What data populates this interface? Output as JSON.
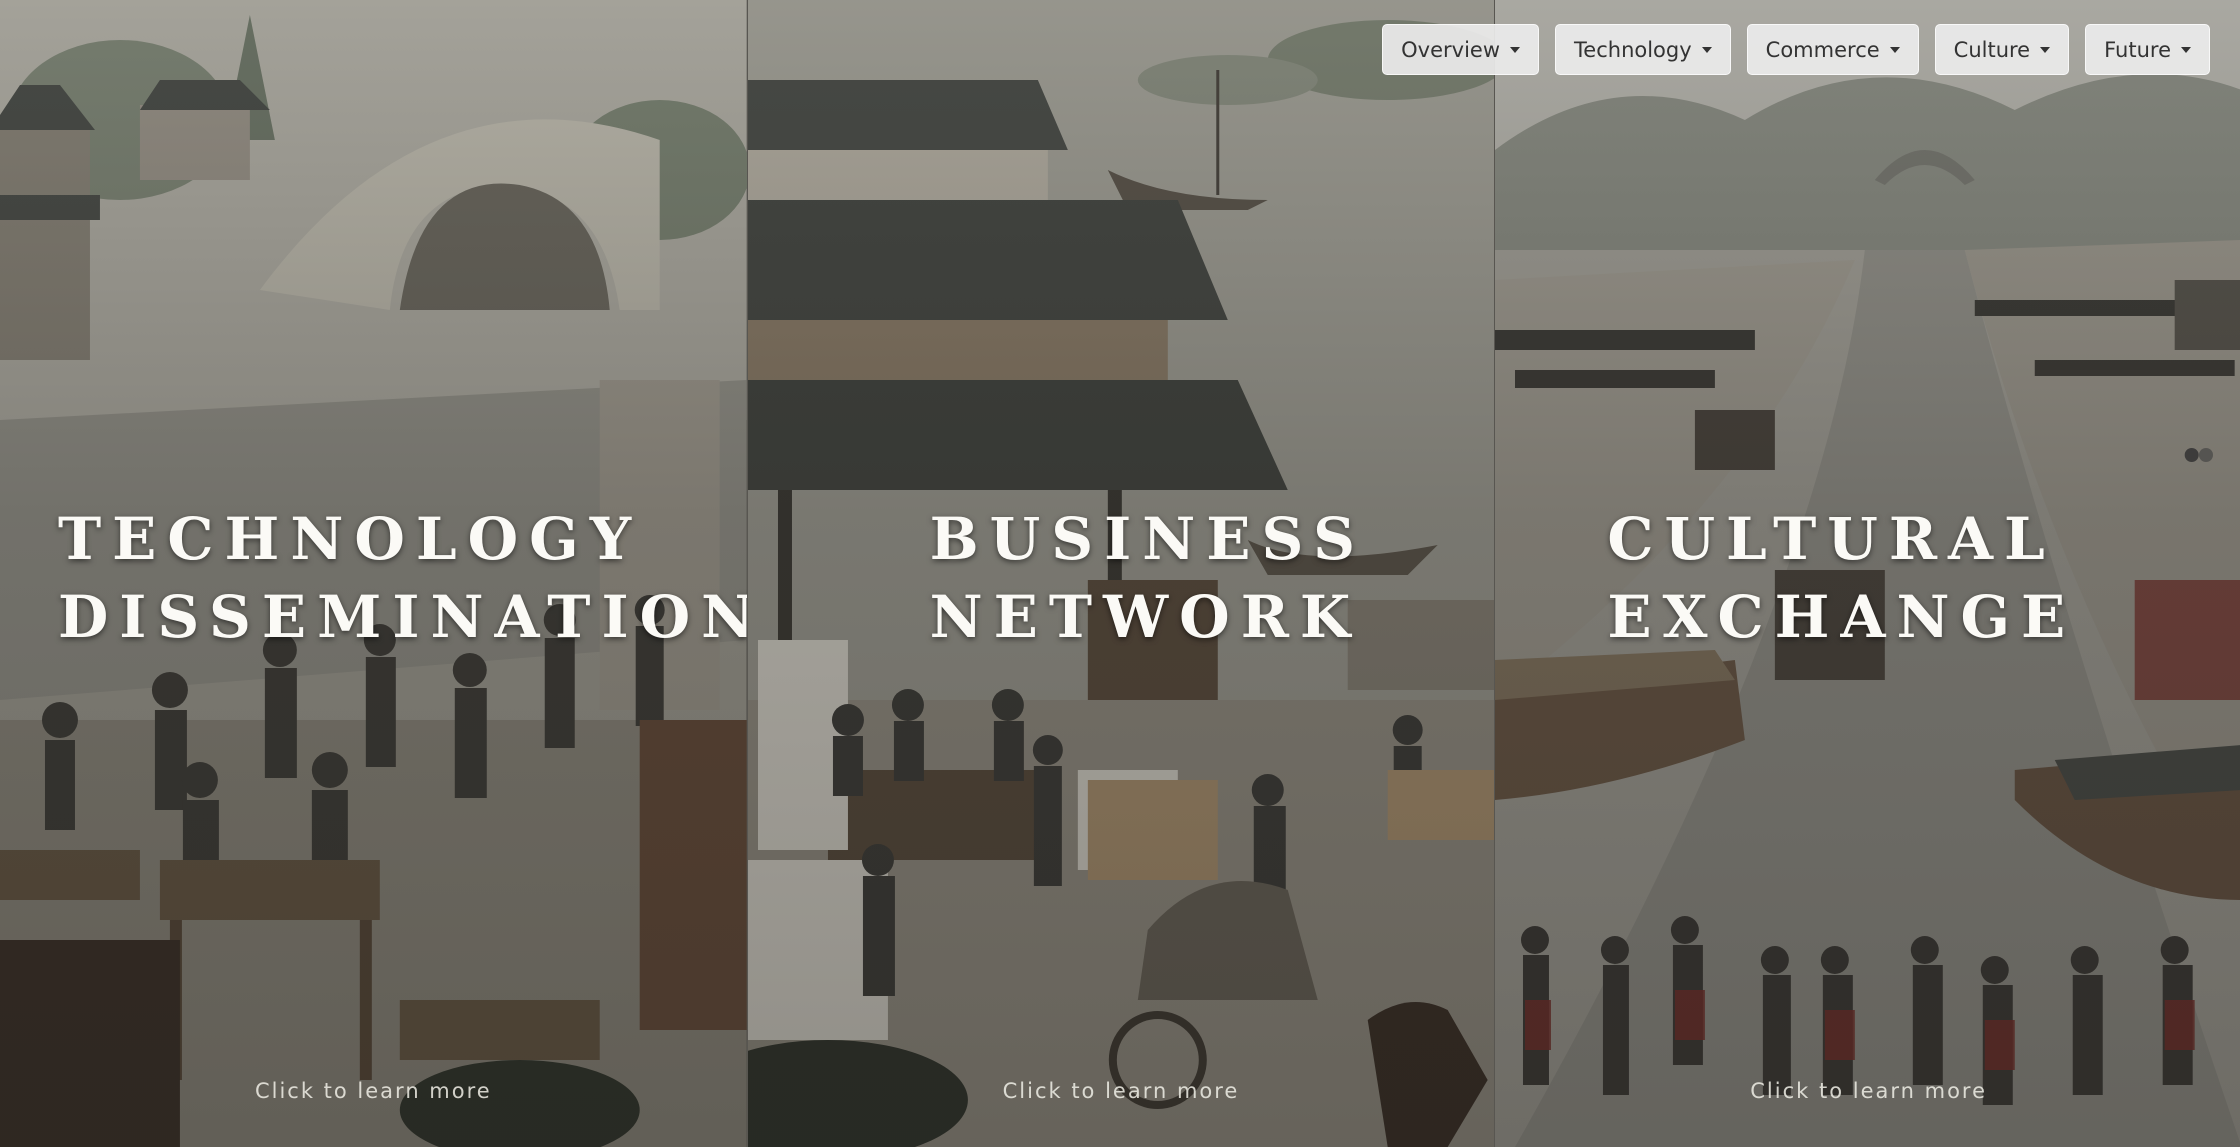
{
  "nav": [
    {
      "label": "Overview",
      "icon": "caret-down-icon"
    },
    {
      "label": "Technology",
      "icon": "caret-down-icon"
    },
    {
      "label": "Commerce",
      "icon": "caret-down-icon"
    },
    {
      "label": "Culture",
      "icon": "caret-down-icon"
    },
    {
      "label": "Future",
      "icon": "caret-down-icon"
    }
  ],
  "panels": [
    {
      "title_line1": "TECHNOLOGY",
      "title_line2": "DISSEMINATION",
      "cta": "Click to learn more"
    },
    {
      "title_line1": "BUSINESS",
      "title_line2": "NETWORK",
      "cta": "Click to learn more"
    },
    {
      "title_line1": "CULTURAL",
      "title_line2": "EXCHANGE",
      "cta": "Click to learn more"
    }
  ],
  "colors": {
    "title": "#fbfaf6",
    "nav_bg": "#ececec",
    "nav_text": "#333333",
    "water": "#9c9b93",
    "roof": "#4b4e4a"
  }
}
